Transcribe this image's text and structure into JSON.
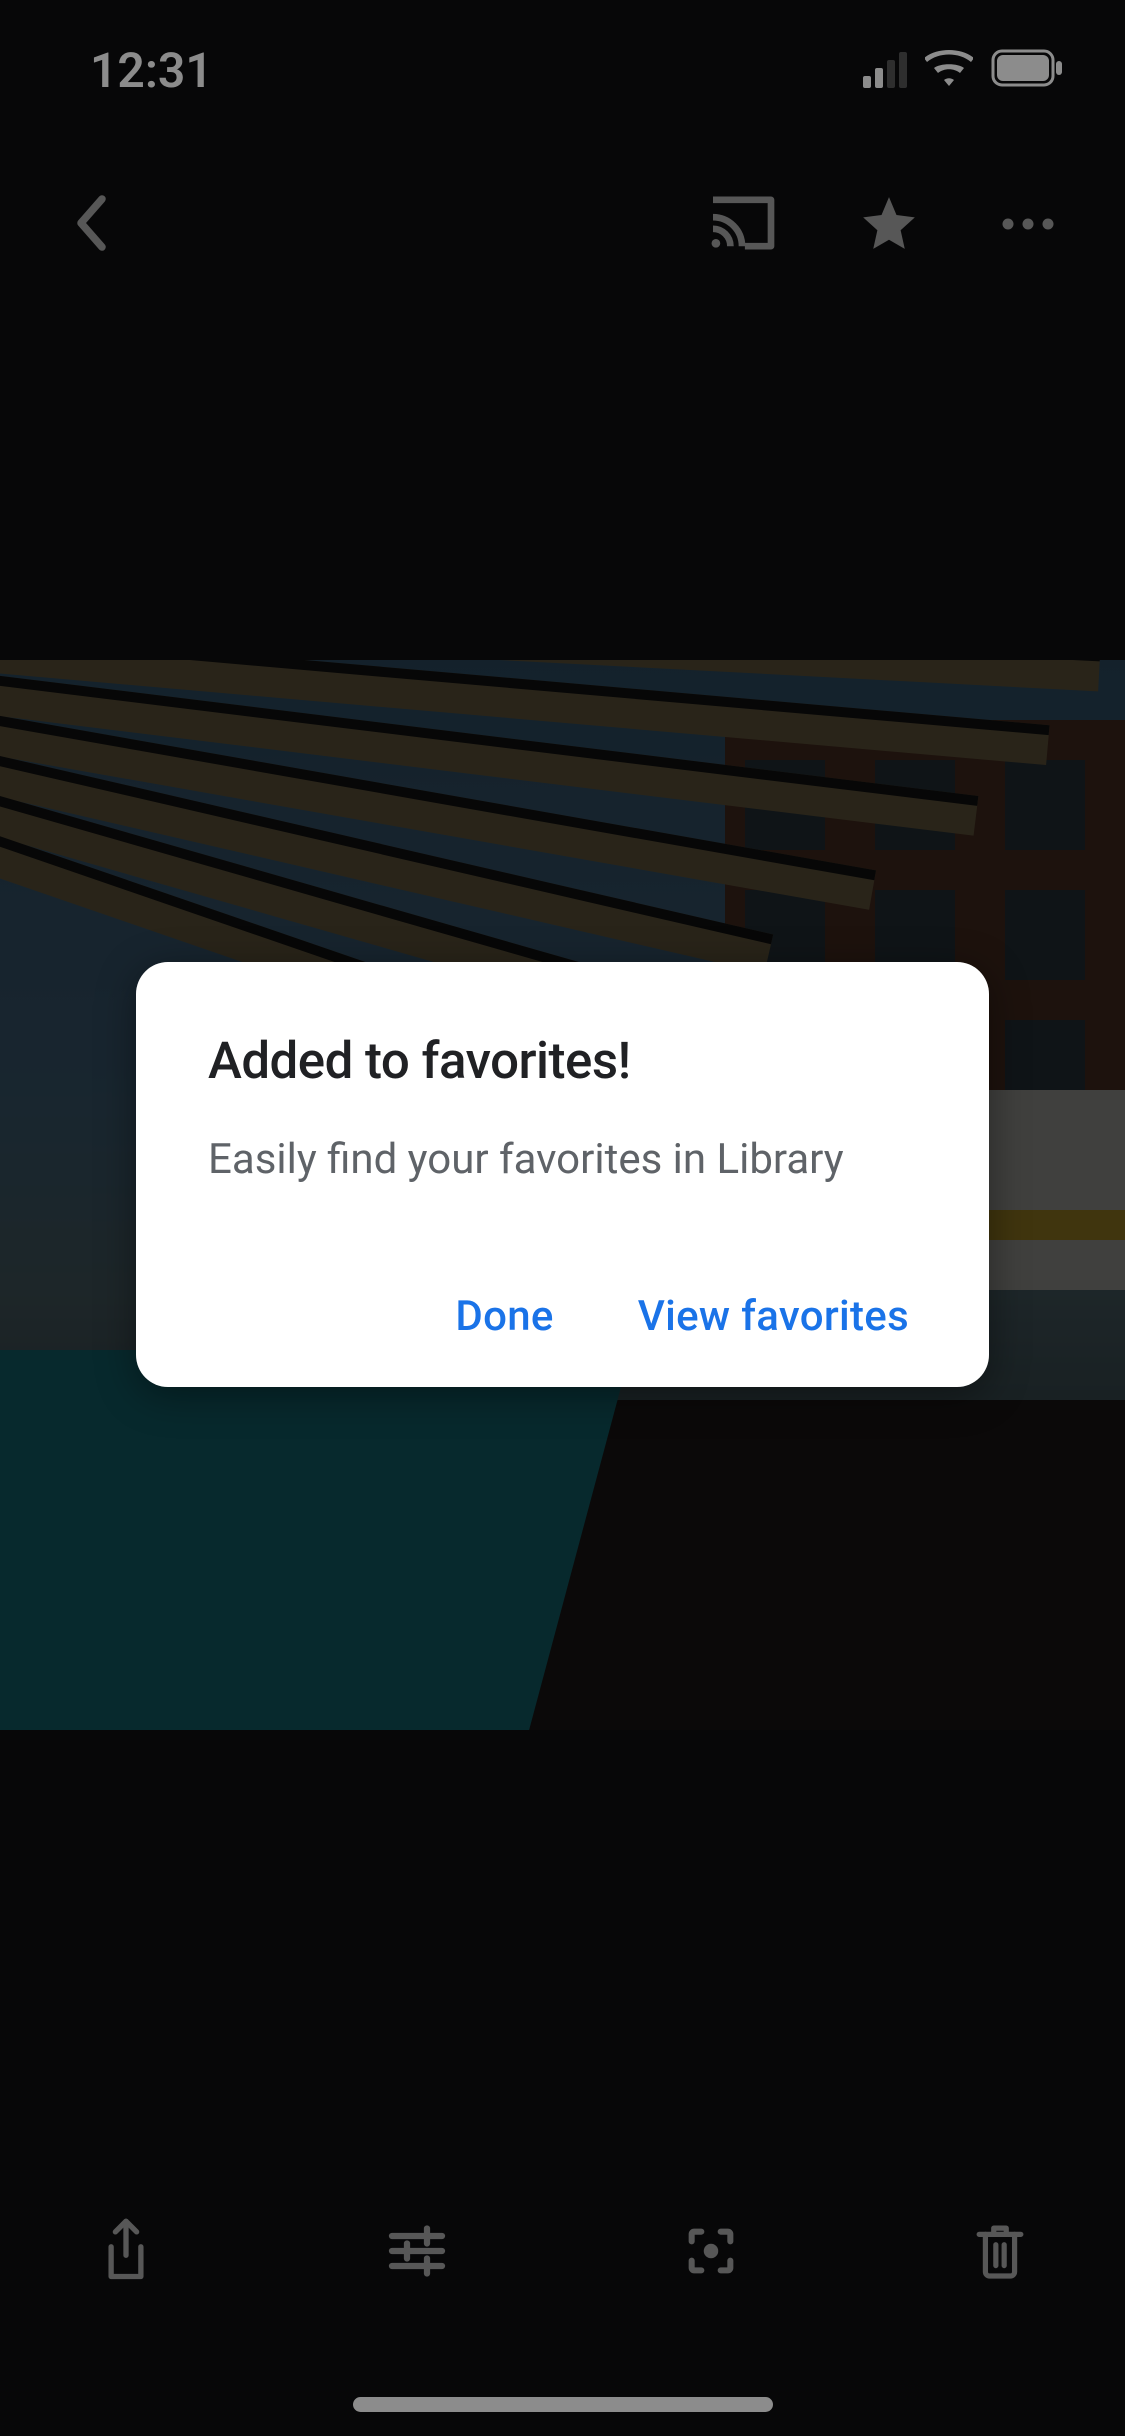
{
  "status": {
    "time": "12:31"
  },
  "dialog": {
    "title": "Added to favorites!",
    "body": "Easily find your favorites in Library",
    "done_label": "Done",
    "view_label": "View favorites"
  }
}
